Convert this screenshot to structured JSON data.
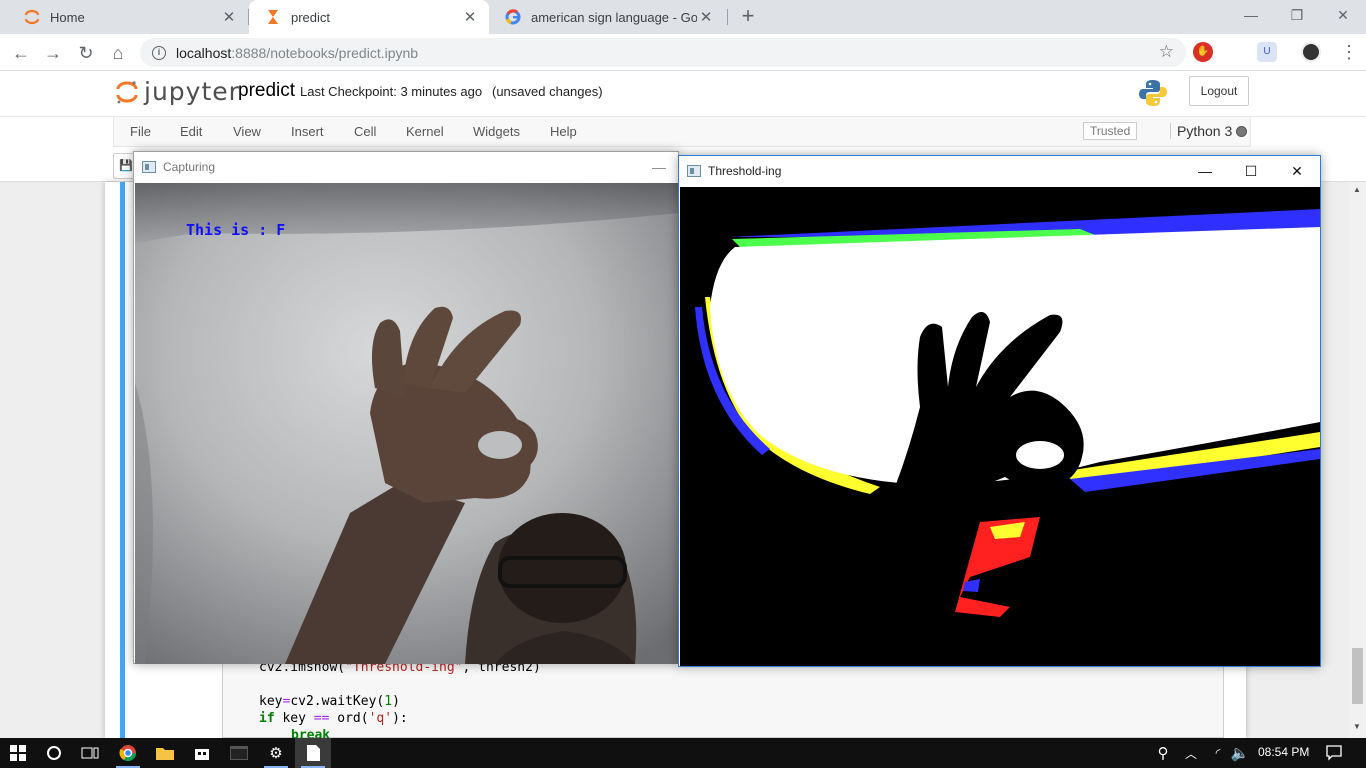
{
  "browser": {
    "tabs": [
      {
        "label": "Home",
        "icon": "jupyter-icon"
      },
      {
        "label": "predict",
        "icon": "hourglass-icon"
      },
      {
        "label": "american sign language - Google",
        "icon": "google-icon"
      }
    ],
    "new_tab_symbol": "+",
    "url_host": "localhost",
    "url_path": ":8888/notebooks/predict.ipynb"
  },
  "jupyter": {
    "logo_text": "jupyter",
    "notebook_name": "predict",
    "checkpoint": "Last Checkpoint: 3 minutes ago",
    "status": "(unsaved changes)",
    "logout_label": "Logout",
    "menu": [
      "File",
      "Edit",
      "View",
      "Insert",
      "Cell",
      "Kernel",
      "Widgets",
      "Help"
    ],
    "trusted_label": "Trusted",
    "kernel_name": "Python 3"
  },
  "code": {
    "line1_fn": "cv2.imshow(",
    "line1_str": "\"Threshold-ing\"",
    "line1_rest": ", thresh2)",
    "line2_lhs": "key",
    "line2_op": "=",
    "line2_fn": "cv2.waitKey(",
    "line2_num": "1",
    "line2_close": ")",
    "line3_kw": "if",
    "line3_mid": " key ",
    "line3_op": "==",
    "line3_fn": " ord(",
    "line3_str": "'q'",
    "line3_close": "):",
    "line4_kw": "break"
  },
  "windows": {
    "capture_title": "Capturing",
    "capture_overlay_text": "This is : F",
    "threshold_title": "Threshold-ing"
  },
  "taskbar": {
    "time": "08:54 PM"
  },
  "colors": {
    "jupyter_orange": "#f37726",
    "cell_selected": "#42a5f5",
    "overlay_text": "#1010ff"
  }
}
